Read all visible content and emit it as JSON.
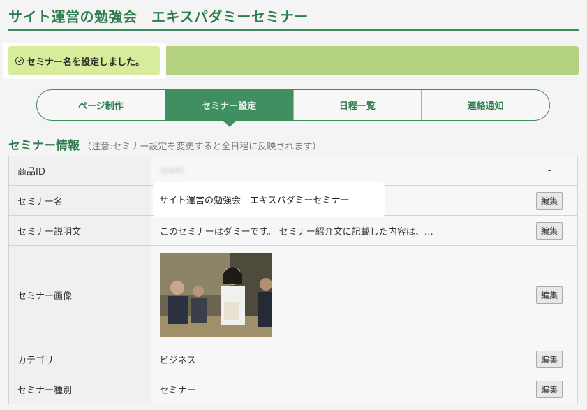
{
  "page": {
    "title": "サイト運営の勉強会　エキスパダミーセミナー"
  },
  "notice": {
    "message": "セミナー名を設定しました。"
  },
  "tabs": [
    {
      "label": "ページ制作"
    },
    {
      "label": "セミナー設定"
    },
    {
      "label": "日程一覧"
    },
    {
      "label": "連絡通知"
    }
  ],
  "section": {
    "title": "セミナー情報",
    "note": "（注意:セミナー設定を変更すると全日程に反映されます）"
  },
  "rows": [
    {
      "label": "商品ID",
      "value": "32445",
      "action": "-"
    },
    {
      "label": "セミナー名",
      "value": "サイト運営の勉強会　エキスパダミーセミナー",
      "action": "編集"
    },
    {
      "label": "セミナー説明文",
      "value": "このセミナーはダミーです。 セミナー紹介文に記載した内容は、…",
      "action": "編集"
    },
    {
      "label": "セミナー画像",
      "value": "",
      "action": "編集"
    },
    {
      "label": "カテゴリ",
      "value": "ビジネス",
      "action": "編集"
    },
    {
      "label": "セミナー種別",
      "value": "セミナー",
      "action": "編集"
    }
  ]
}
